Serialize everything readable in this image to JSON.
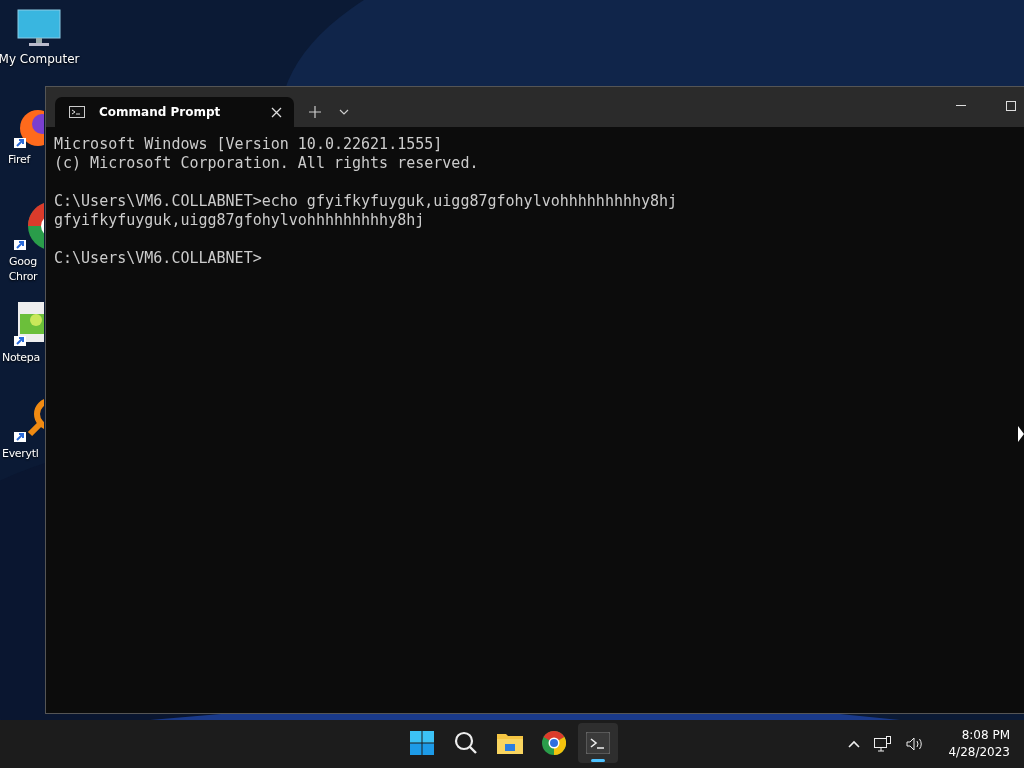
{
  "desktop_icons": [
    {
      "kind": "computer",
      "label": "My Computer"
    },
    {
      "kind": "firefox",
      "label": "Firef"
    },
    {
      "kind": "chrome",
      "label": "Goog Chror"
    },
    {
      "kind": "notepad",
      "label": "Notepa"
    },
    {
      "kind": "everything",
      "label": "Everytl"
    }
  ],
  "window": {
    "tab": {
      "title": "Command Prompt",
      "selected": true
    },
    "blocks": [
      [
        "Microsoft Windows [Version 10.0.22621.1555]",
        "(c) Microsoft Corporation. All rights reserved."
      ],
      [
        "C:\\Users\\VM6.COLLABNET>echo gfyifkyfuyguk,uigg87gfohylvohhhhhhhhhy8hj",
        "gfyifkyfuyguk,uigg87gfohylvohhhhhhhhhy8hj"
      ],
      [
        "C:\\Users\\VM6.COLLABNET>"
      ]
    ]
  },
  "taskbar": {
    "apps": [
      {
        "kind": "start",
        "selected": false
      },
      {
        "kind": "search",
        "selected": false
      },
      {
        "kind": "explorer",
        "selected": false
      },
      {
        "kind": "chrome",
        "selected": false
      },
      {
        "kind": "terminal",
        "selected": true
      }
    ],
    "time": "8:08 PM",
    "date": "4/28/2023"
  }
}
